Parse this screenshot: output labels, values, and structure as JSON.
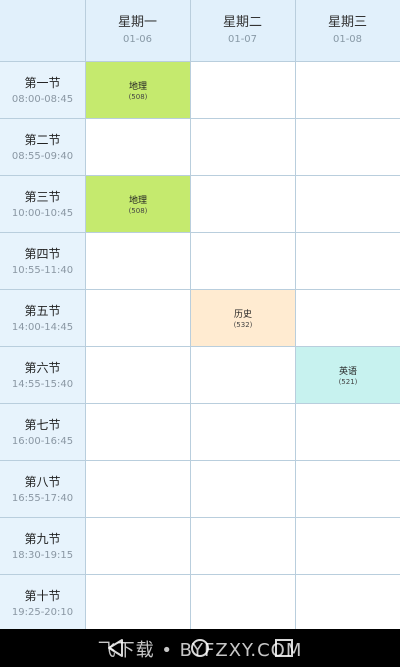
{
  "days": [
    {
      "name": "星期一",
      "date": "01-06"
    },
    {
      "name": "星期二",
      "date": "01-07"
    },
    {
      "name": "星期三",
      "date": "01-08"
    }
  ],
  "periods": [
    {
      "name": "第一节",
      "time": "08:00-08:45"
    },
    {
      "name": "第二节",
      "time": "08:55-09:40"
    },
    {
      "name": "第三节",
      "time": "10:00-10:45"
    },
    {
      "name": "第四节",
      "time": "10:55-11:40"
    },
    {
      "name": "第五节",
      "time": "14:00-14:45"
    },
    {
      "name": "第六节",
      "time": "14:55-15:40"
    },
    {
      "name": "第七节",
      "time": "16:00-16:45"
    },
    {
      "name": "第八节",
      "time": "16:55-17:40"
    },
    {
      "name": "第九节",
      "time": "18:30-19:15"
    },
    {
      "name": "第十节",
      "time": "19:25-20:10"
    }
  ],
  "courses": [
    {
      "name": "地理",
      "room": "(508)",
      "day": 0,
      "period": 0,
      "color": "#c5ea6e"
    },
    {
      "name": "地理",
      "room": "(508)",
      "day": 0,
      "period": 2,
      "color": "#c5ea6e"
    },
    {
      "name": "历史",
      "room": "(532)",
      "day": 1,
      "period": 4,
      "color": "#ffebd1"
    },
    {
      "name": "英语",
      "room": "(521)",
      "day": 2,
      "period": 5,
      "color": "#c7f2ef"
    }
  ],
  "navbar": {
    "buttons": [
      {
        "name": "back-icon"
      },
      {
        "name": "home-icon"
      },
      {
        "name": "recent-apps-icon"
      }
    ]
  },
  "watermark": "飞下载 • BYFZXY.COM",
  "colors": {
    "grid_line": "#b9cedd",
    "header_bg": "#e1f0fb",
    "period_bg": "#e7f3fc",
    "navbar_bg": "#000000"
  }
}
